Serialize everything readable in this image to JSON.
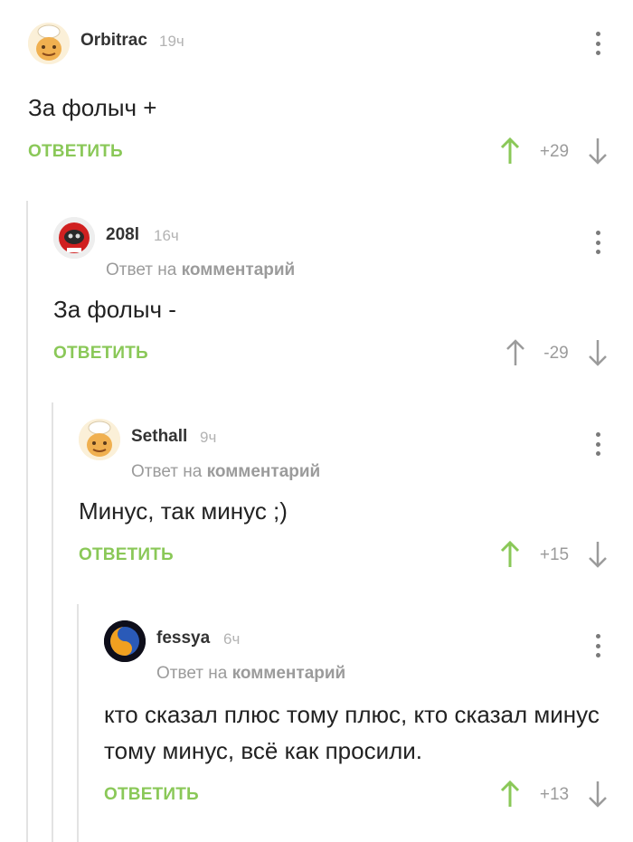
{
  "comments": [
    {
      "author": "Orbitrac",
      "time": "19ч",
      "text": "За фолыч +",
      "reply_label": "ОТВЕТИТЬ",
      "score": "+29",
      "upvoted": true
    },
    {
      "author": "208l",
      "time": "16ч",
      "reply_to_prefix": "Ответ на",
      "reply_to_link": "комментарий",
      "text": "За фолыч -",
      "reply_label": "ОТВЕТИТЬ",
      "score": "-29",
      "upvoted": false
    },
    {
      "author": "Sethall",
      "time": "9ч",
      "reply_to_prefix": "Ответ на",
      "reply_to_link": "комментарий",
      "text": "Минус, так минус ;)",
      "reply_label": "ОТВЕТИТЬ",
      "score": "+15",
      "upvoted": true
    },
    {
      "author": "fessya",
      "time": "6ч",
      "reply_to_prefix": "Ответ на",
      "reply_to_link": "комментарий",
      "text": "кто сказал плюс тому плюс, кто сказал минус тому минус, всё как просили.",
      "reply_label": "ОТВЕТИТЬ",
      "score": "+13",
      "upvoted": true
    }
  ],
  "colors": {
    "accent_green": "#8ac858",
    "muted_gray": "#9b9b9b",
    "thread_line": "#e3e3e3"
  },
  "icons": [
    "more-vertical-icon",
    "arrow-up-icon",
    "arrow-down-icon",
    "avatar"
  ]
}
